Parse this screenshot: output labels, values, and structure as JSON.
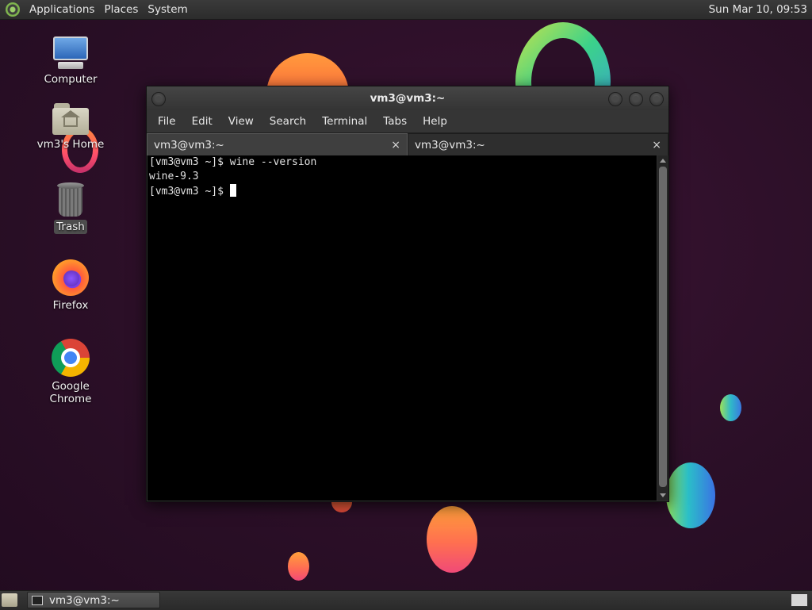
{
  "top_panel": {
    "menus": [
      "Applications",
      "Places",
      "System"
    ],
    "clock": "Sun Mar 10, 09:53"
  },
  "desktop_icons": [
    {
      "label": "Computer",
      "icon": "computer-icon"
    },
    {
      "label": "vm3's Home",
      "icon": "home-folder-icon"
    },
    {
      "label": "Trash",
      "icon": "trash-icon"
    },
    {
      "label": "Firefox",
      "icon": "firefox-icon"
    },
    {
      "label": "Google Chrome",
      "icon": "chrome-icon"
    }
  ],
  "terminal": {
    "title": "vm3@vm3:~",
    "menu": [
      "File",
      "Edit",
      "View",
      "Search",
      "Terminal",
      "Tabs",
      "Help"
    ],
    "tabs": [
      {
        "label": "vm3@vm3:~",
        "close": "×"
      },
      {
        "label": "vm3@vm3:~",
        "close": "×"
      }
    ],
    "lines": [
      "[vm3@vm3 ~]$ wine --version",
      "wine-9.3",
      "[vm3@vm3 ~]$ "
    ]
  },
  "taskbar": {
    "task_label": "vm3@vm3:~"
  },
  "colors": {
    "wallpaper": "#2b0f27",
    "panel": "#333333",
    "terminal_bg": "#000000"
  }
}
